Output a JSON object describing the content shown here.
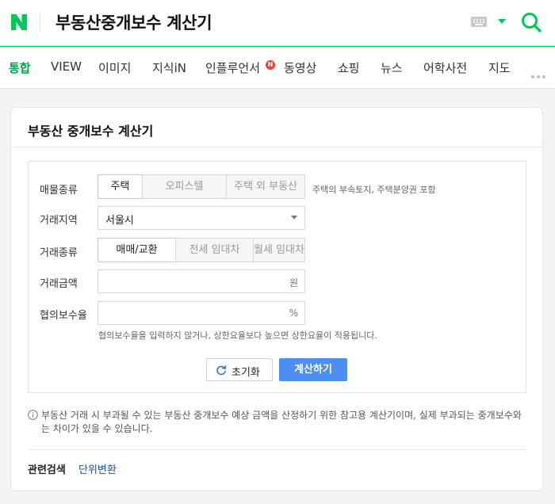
{
  "header": {
    "title": "부동산중개보수 계산기",
    "logo_letter": "N",
    "icons": [
      "naver-logo-icon",
      "keyboard-icon",
      "dropdown-caret-icon",
      "search-icon"
    ]
  },
  "tabs": [
    {
      "label": "통합",
      "active": true
    },
    {
      "label": "VIEW"
    },
    {
      "label": "이미지"
    },
    {
      "label": "지식iN"
    },
    {
      "label": "인플루언서",
      "badge": "N"
    },
    {
      "label": "동영상"
    },
    {
      "label": "쇼핑"
    },
    {
      "label": "뉴스"
    },
    {
      "label": "어학사전"
    },
    {
      "label": "지도"
    }
  ],
  "card": {
    "title": "부동산 중개보수 계산기",
    "property_type": {
      "label": "매물종류",
      "options": [
        "주택",
        "오피스텔",
        "주택 외 부동산"
      ],
      "selected": "주택",
      "hint": "주택의 부속토지, 주택분양권 포함"
    },
    "region": {
      "label": "거래지역",
      "value": "서울시"
    },
    "deal_type": {
      "label": "거래종류",
      "options": [
        "매매/교환",
        "전세 임대차",
        "월세 임대차"
      ],
      "selected": "매매/교환"
    },
    "amount": {
      "label": "거래금액",
      "value": "",
      "unit": "원"
    },
    "rate": {
      "label": "협의보수율",
      "value": "",
      "unit": "%",
      "hint": "협의보수율을 입력하지 않거나, 상한요율보다 높으면 상한요율이 적용됩니다."
    },
    "buttons": {
      "reset": "초기화",
      "calculate": "계산하기"
    },
    "notice": "부동산 거래 시 부과될 수 있는 부동산 중개보수 예상 금액을 산정하기 위한 참고용 계산기이며, 실제 부과되는 중개보수와는 차이가 있을 수 있습니다.",
    "related": {
      "label": "관련검색",
      "link": "단위변환"
    }
  },
  "colors": {
    "brand": "#03c75a",
    "primary_button": "#4d8ef3",
    "badge": "#f03d3d",
    "link": "#1a4fa0"
  }
}
